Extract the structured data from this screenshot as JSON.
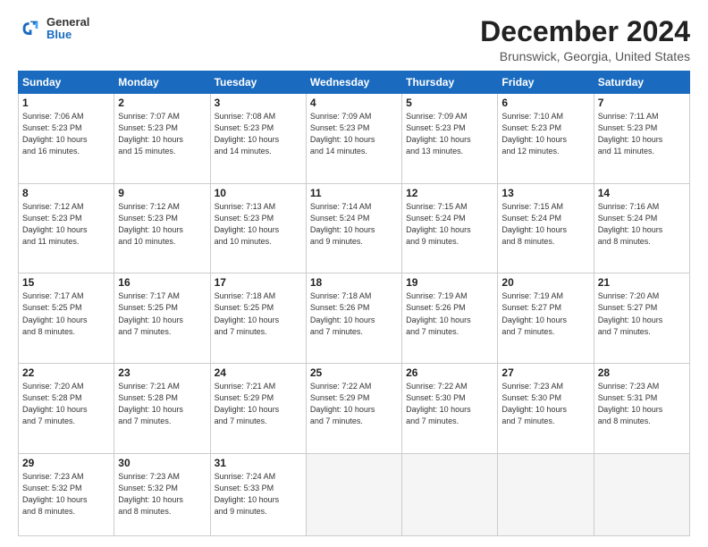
{
  "logo": {
    "general": "General",
    "blue": "Blue"
  },
  "header": {
    "title": "December 2024",
    "subtitle": "Brunswick, Georgia, United States"
  },
  "days_of_week": [
    "Sunday",
    "Monday",
    "Tuesday",
    "Wednesday",
    "Thursday",
    "Friday",
    "Saturday"
  ],
  "weeks": [
    [
      {
        "day": "1",
        "info": "Sunrise: 7:06 AM\nSunset: 5:23 PM\nDaylight: 10 hours\nand 16 minutes."
      },
      {
        "day": "2",
        "info": "Sunrise: 7:07 AM\nSunset: 5:23 PM\nDaylight: 10 hours\nand 15 minutes."
      },
      {
        "day": "3",
        "info": "Sunrise: 7:08 AM\nSunset: 5:23 PM\nDaylight: 10 hours\nand 14 minutes."
      },
      {
        "day": "4",
        "info": "Sunrise: 7:09 AM\nSunset: 5:23 PM\nDaylight: 10 hours\nand 14 minutes."
      },
      {
        "day": "5",
        "info": "Sunrise: 7:09 AM\nSunset: 5:23 PM\nDaylight: 10 hours\nand 13 minutes."
      },
      {
        "day": "6",
        "info": "Sunrise: 7:10 AM\nSunset: 5:23 PM\nDaylight: 10 hours\nand 12 minutes."
      },
      {
        "day": "7",
        "info": "Sunrise: 7:11 AM\nSunset: 5:23 PM\nDaylight: 10 hours\nand 11 minutes."
      }
    ],
    [
      {
        "day": "8",
        "info": "Sunrise: 7:12 AM\nSunset: 5:23 PM\nDaylight: 10 hours\nand 11 minutes."
      },
      {
        "day": "9",
        "info": "Sunrise: 7:12 AM\nSunset: 5:23 PM\nDaylight: 10 hours\nand 10 minutes."
      },
      {
        "day": "10",
        "info": "Sunrise: 7:13 AM\nSunset: 5:23 PM\nDaylight: 10 hours\nand 10 minutes."
      },
      {
        "day": "11",
        "info": "Sunrise: 7:14 AM\nSunset: 5:24 PM\nDaylight: 10 hours\nand 9 minutes."
      },
      {
        "day": "12",
        "info": "Sunrise: 7:15 AM\nSunset: 5:24 PM\nDaylight: 10 hours\nand 9 minutes."
      },
      {
        "day": "13",
        "info": "Sunrise: 7:15 AM\nSunset: 5:24 PM\nDaylight: 10 hours\nand 8 minutes."
      },
      {
        "day": "14",
        "info": "Sunrise: 7:16 AM\nSunset: 5:24 PM\nDaylight: 10 hours\nand 8 minutes."
      }
    ],
    [
      {
        "day": "15",
        "info": "Sunrise: 7:17 AM\nSunset: 5:25 PM\nDaylight: 10 hours\nand 8 minutes."
      },
      {
        "day": "16",
        "info": "Sunrise: 7:17 AM\nSunset: 5:25 PM\nDaylight: 10 hours\nand 7 minutes."
      },
      {
        "day": "17",
        "info": "Sunrise: 7:18 AM\nSunset: 5:25 PM\nDaylight: 10 hours\nand 7 minutes."
      },
      {
        "day": "18",
        "info": "Sunrise: 7:18 AM\nSunset: 5:26 PM\nDaylight: 10 hours\nand 7 minutes."
      },
      {
        "day": "19",
        "info": "Sunrise: 7:19 AM\nSunset: 5:26 PM\nDaylight: 10 hours\nand 7 minutes."
      },
      {
        "day": "20",
        "info": "Sunrise: 7:19 AM\nSunset: 5:27 PM\nDaylight: 10 hours\nand 7 minutes."
      },
      {
        "day": "21",
        "info": "Sunrise: 7:20 AM\nSunset: 5:27 PM\nDaylight: 10 hours\nand 7 minutes."
      }
    ],
    [
      {
        "day": "22",
        "info": "Sunrise: 7:20 AM\nSunset: 5:28 PM\nDaylight: 10 hours\nand 7 minutes."
      },
      {
        "day": "23",
        "info": "Sunrise: 7:21 AM\nSunset: 5:28 PM\nDaylight: 10 hours\nand 7 minutes."
      },
      {
        "day": "24",
        "info": "Sunrise: 7:21 AM\nSunset: 5:29 PM\nDaylight: 10 hours\nand 7 minutes."
      },
      {
        "day": "25",
        "info": "Sunrise: 7:22 AM\nSunset: 5:29 PM\nDaylight: 10 hours\nand 7 minutes."
      },
      {
        "day": "26",
        "info": "Sunrise: 7:22 AM\nSunset: 5:30 PM\nDaylight: 10 hours\nand 7 minutes."
      },
      {
        "day": "27",
        "info": "Sunrise: 7:23 AM\nSunset: 5:30 PM\nDaylight: 10 hours\nand 7 minutes."
      },
      {
        "day": "28",
        "info": "Sunrise: 7:23 AM\nSunset: 5:31 PM\nDaylight: 10 hours\nand 8 minutes."
      }
    ],
    [
      {
        "day": "29",
        "info": "Sunrise: 7:23 AM\nSunset: 5:32 PM\nDaylight: 10 hours\nand 8 minutes."
      },
      {
        "day": "30",
        "info": "Sunrise: 7:23 AM\nSunset: 5:32 PM\nDaylight: 10 hours\nand 8 minutes."
      },
      {
        "day": "31",
        "info": "Sunrise: 7:24 AM\nSunset: 5:33 PM\nDaylight: 10 hours\nand 9 minutes."
      },
      {
        "day": "",
        "info": ""
      },
      {
        "day": "",
        "info": ""
      },
      {
        "day": "",
        "info": ""
      },
      {
        "day": "",
        "info": ""
      }
    ]
  ]
}
